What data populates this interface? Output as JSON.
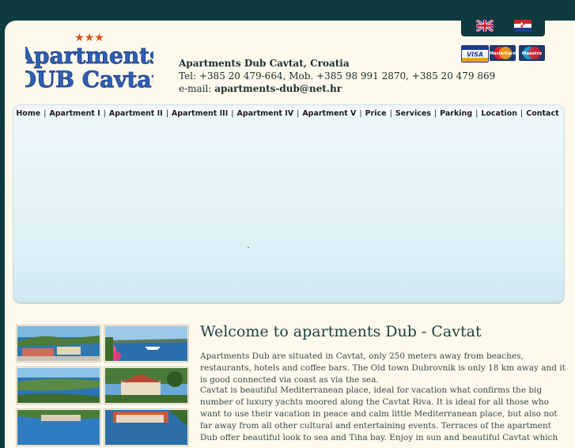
{
  "languages": [
    {
      "name": "English",
      "icon": "uk-flag-icon"
    },
    {
      "name": "Hrvatski",
      "icon": "croatian-flag-icon"
    }
  ],
  "payment_cards": [
    "VISA",
    "MasterCard",
    "Maestro"
  ],
  "logo": {
    "stars": "★★★",
    "line1": "Apartments",
    "line2": "DUB Cavtat"
  },
  "contact": {
    "name": "Apartments Dub Cavtat, Croatia",
    "phones": "Tel: +385 20 479-664, Mob. +385 98 991 2870, +385 20 479 869",
    "email_label": "e-mail: ",
    "email": "apartments-dub@net.hr"
  },
  "nav": [
    "Home",
    "Apartment I",
    "Apartment II",
    "Apartment III",
    "Apartment IV",
    "Apartment V",
    "Price",
    "Services",
    "Parking",
    "Location",
    "Contact"
  ],
  "welcome_title": "Welcome to apartments Dub - Cavtat",
  "paragraphs": [
    "Apartments Dub are situated in Cavtat, only 250 meters away from beaches, restaurants, hotels and coffee bars. The Old town Dubrovnik is only 18 km away and it is good connected via coast as via the sea.",
    "Cavtat is beautiful Mediterranean place, ideal for vacation what confirms the big number of luxury yachts moored along the Cavtat Riva. It is ideal for all those who want to use their vacation in peace and calm little Mediterranean place, but also not far away from all other cultural and entertaining events. Terraces of the apartment Dub offer beautiful look to sea and Tiha bay. Enjoy in sun and beautiful Cavtat which"
  ],
  "colors": {
    "accent": "#0f3b3e",
    "background": "#fdf9ec",
    "banner": "#dff1f7"
  }
}
